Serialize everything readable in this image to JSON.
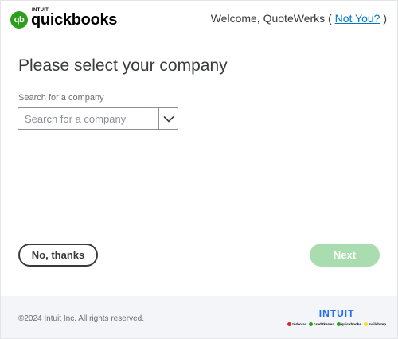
{
  "header": {
    "logo_mark": "qb",
    "logo_intuit": "INTUIT",
    "logo_name": "quickbooks",
    "welcome_prefix": "Welcome, QuoteWerks (",
    "not_you_link": "Not You?",
    "welcome_suffix": ")"
  },
  "main": {
    "title": "Please select your company",
    "search_label": "Search for a company",
    "search_placeholder": "Search for a company",
    "search_value": ""
  },
  "actions": {
    "no_thanks_label": "No, thanks",
    "next_label": "Next"
  },
  "footer": {
    "copyright": "©2024 Intuit Inc. All rights reserved.",
    "brand_word": "INTUIT",
    "products": [
      {
        "name": "turbotax",
        "color": "#d52b1e"
      },
      {
        "name": "creditkarma",
        "color": "#2ca01c"
      },
      {
        "name": "quickbooks",
        "color": "#2ca01c"
      },
      {
        "name": "mailchimp",
        "color": "#ffe01b"
      }
    ]
  },
  "colors": {
    "brand_green": "#2ca01c",
    "link_blue": "#0077c5",
    "next_disabled": "#a9ddb0",
    "intuit_blue": "#236cff"
  }
}
